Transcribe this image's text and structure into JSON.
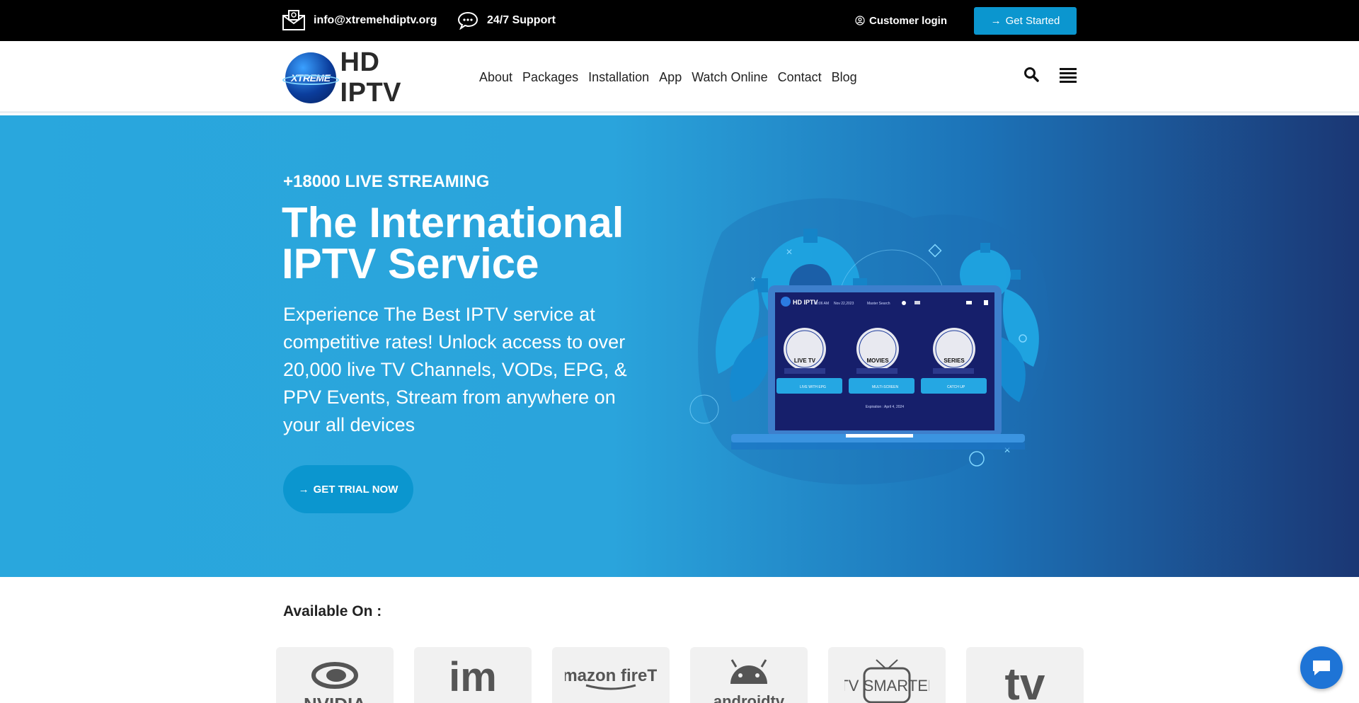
{
  "topbar": {
    "email": "info@xtremehdiptv.org",
    "support": "24/7 Support",
    "login": "Customer login",
    "get_started": "Get Started"
  },
  "header": {
    "logo_ball": "XTREME",
    "logo_text": "HD IPTV",
    "nav": [
      "About",
      "Packages",
      "Installation",
      "App",
      "Watch Online",
      "Contact",
      "Blog"
    ]
  },
  "hero": {
    "kicker": "+18000 LIVE STREAMING",
    "title": "The International IPTV Service",
    "desc": "Experience The Best IPTV service at competitive rates! Unlock access to over 20,000 live TV Channels, VODs, EPG, & PPV Events, Stream from anywhere on your all devices",
    "trial": "GET TRIAL NOW"
  },
  "illustration": {
    "app_title": "HD IPTV",
    "time": "00:06 AM",
    "date": "Nov 22,2023",
    "search": "Master Search",
    "tiles": [
      "LIVE TV",
      "MOVIES",
      "SERIES"
    ],
    "buttons": [
      "LIVE WITH EPG",
      "MULTI-SCREEN",
      "CATCH UP"
    ],
    "expiration": "Expiration : April 4, 2024"
  },
  "available": {
    "title": "Available On :",
    "platforms": [
      "NVIDIA",
      "im",
      "amazon fireTV",
      "androidtv",
      "IPTV SMARTERS",
      "tv"
    ]
  },
  "colors": {
    "accent": "#0b96cf",
    "hero_start": "#29a7dd",
    "hero_end": "#1b3774"
  }
}
